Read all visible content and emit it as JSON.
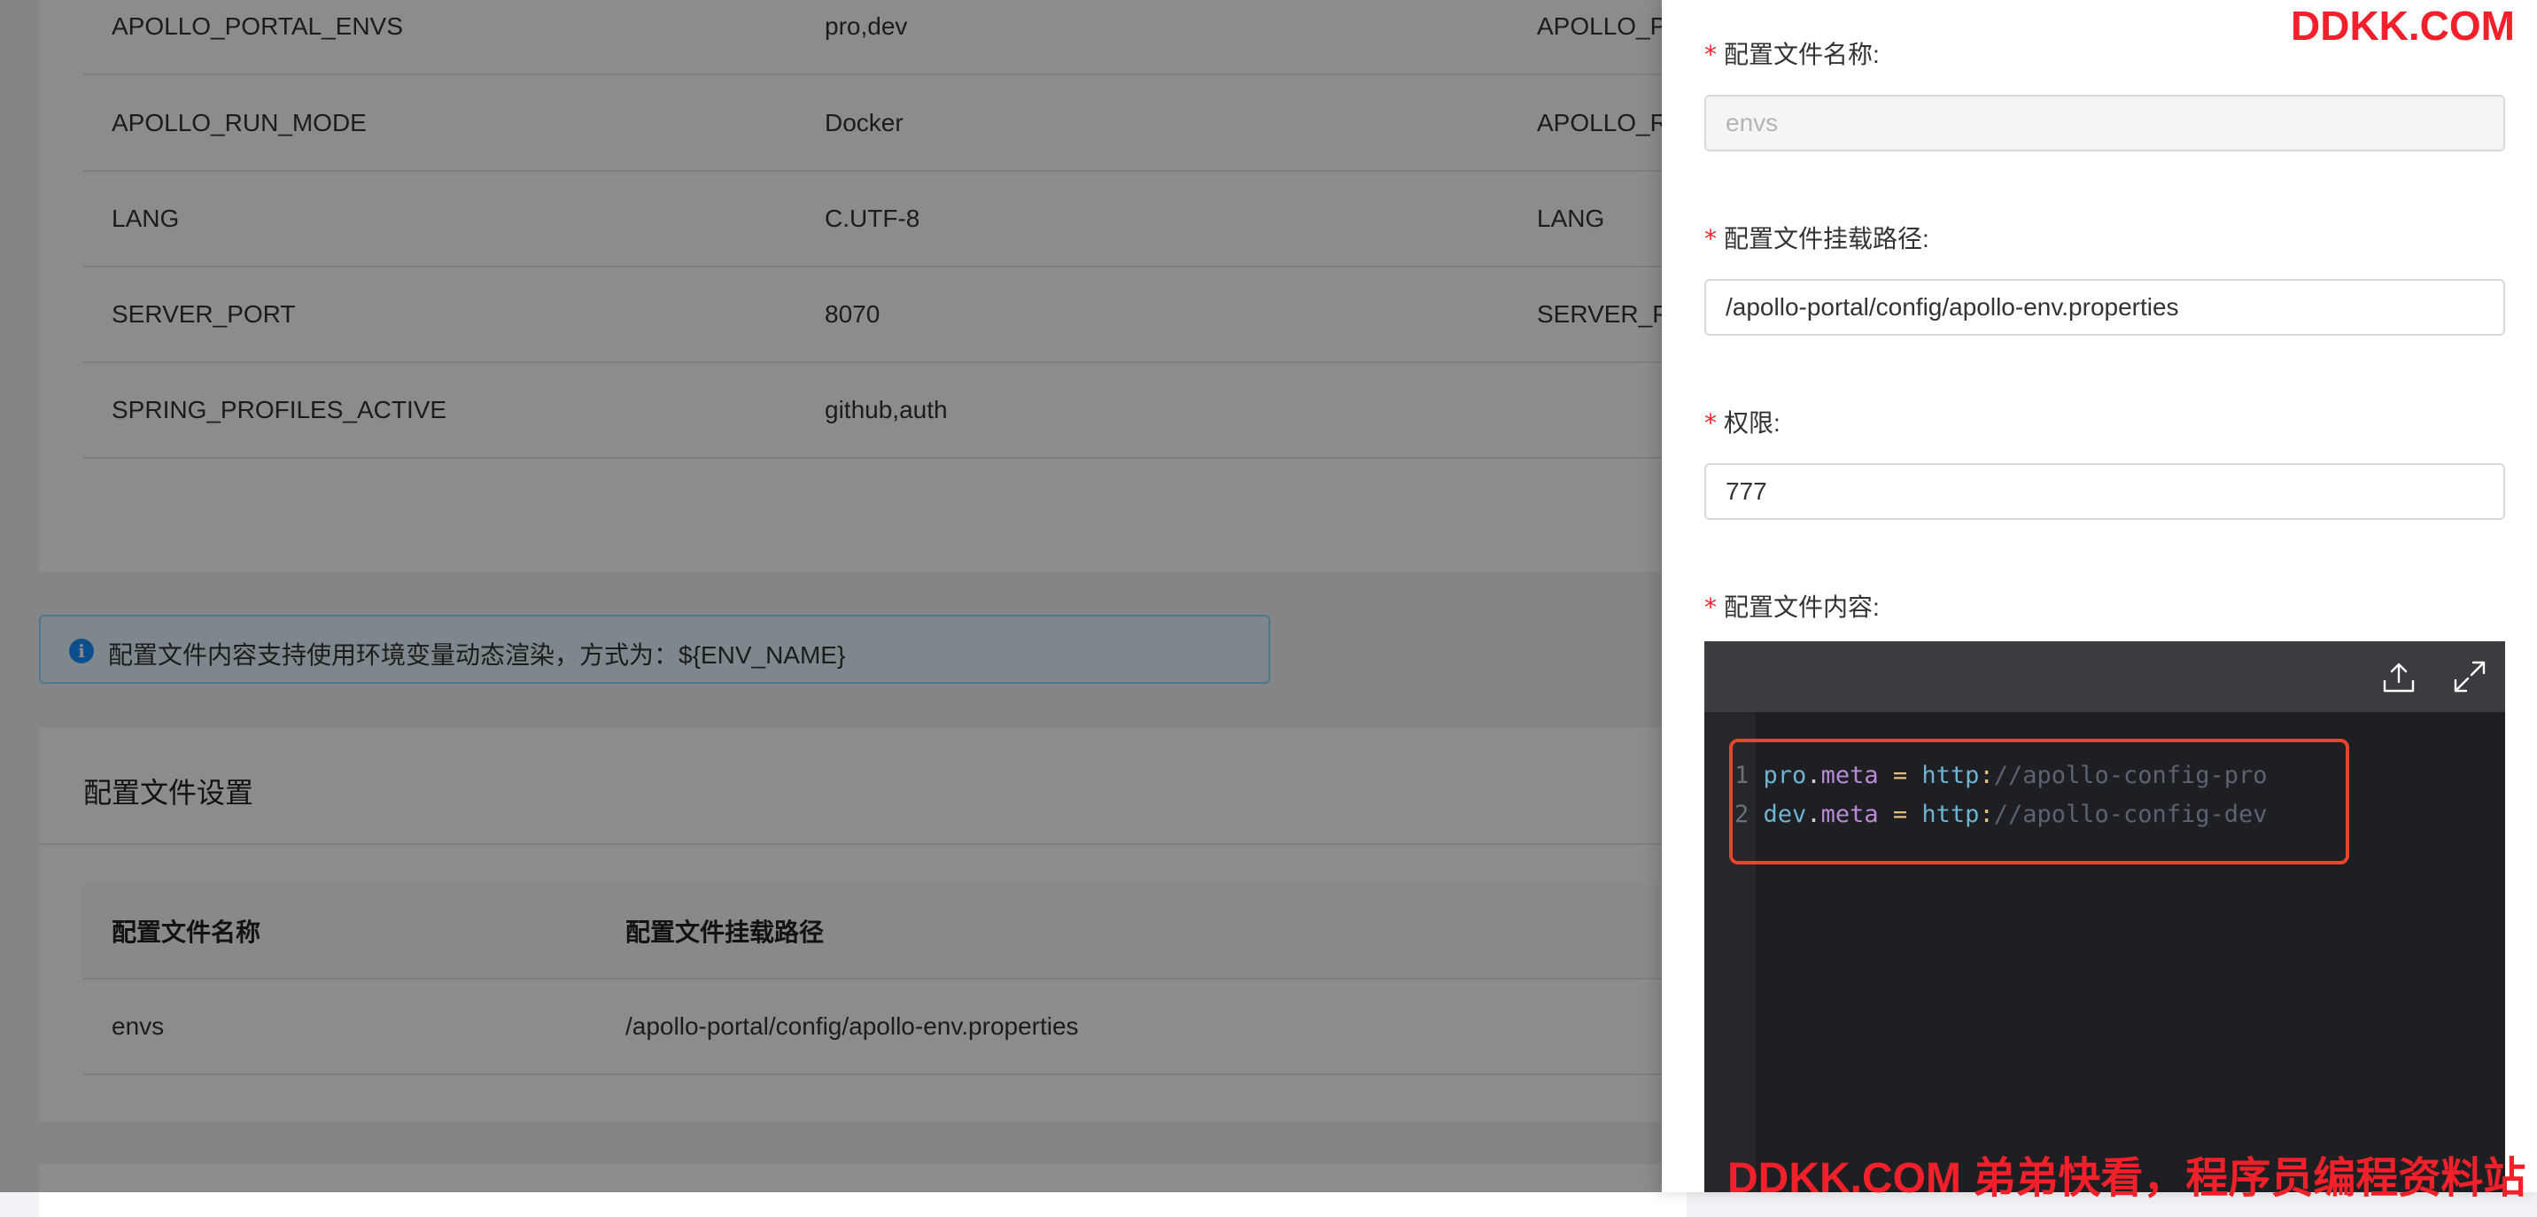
{
  "env_table": {
    "rows": [
      {
        "name": "APOLLO_PORTAL_ENVS",
        "value": "pro,dev",
        "key": "APOLLO_P"
      },
      {
        "name": "APOLLO_RUN_MODE",
        "value": "Docker",
        "key": "APOLLO_R"
      },
      {
        "name": "LANG",
        "value": "C.UTF-8",
        "key": "LANG"
      },
      {
        "name": "SERVER_PORT",
        "value": "8070",
        "key": "SERVER_P"
      },
      {
        "name": "SPRING_PROFILES_ACTIVE",
        "value": "github,auth",
        "key": ""
      }
    ]
  },
  "alert": {
    "text": "配置文件内容支持使用环境变量动态渲染，方式为：${ENV_NAME}",
    "icon": "info-circle-icon"
  },
  "config_file_card": {
    "title": "配置文件设置",
    "columns": [
      "配置文件名称",
      "配置文件挂载路径"
    ],
    "rows": [
      {
        "name": "envs",
        "path": "/apollo-portal/config/apollo-env.properties"
      }
    ]
  },
  "drawer": {
    "required_mark": "*",
    "name_label": "配置文件名称:",
    "name_value": "envs",
    "path_label": "配置文件挂载路径:",
    "path_value": "/apollo-portal/config/apollo-env.properties",
    "perm_label": "权限:",
    "perm_value": "777",
    "content_label": "配置文件内容:",
    "editor": {
      "toolbar_icons": [
        "upload-icon",
        "fullscreen-icon"
      ],
      "lines": [
        {
          "num": "1",
          "key": "pro",
          "prop": "meta",
          "op": "=",
          "proto": "http",
          "rest": "//apollo-config-pro"
        },
        {
          "num": "2",
          "key": "dev",
          "prop": "meta",
          "op": "=",
          "proto": "http",
          "rest": "//apollo-config-dev"
        }
      ]
    }
  },
  "watermark": {
    "top": "DDKK.COM",
    "bottom": "DDKK.COM 弟弟快看，程序员编程资料站"
  },
  "colors": {
    "accent": "#1890ff",
    "required": "#f5222d",
    "watermark": "#f2202a",
    "highlight": "#e8452c"
  }
}
